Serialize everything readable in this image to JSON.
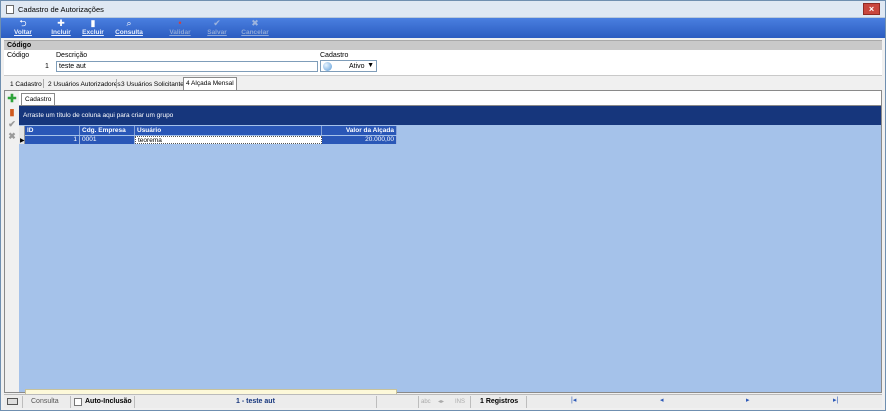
{
  "window": {
    "title": "Cadastro de Autorizações"
  },
  "toolbar": {
    "buttons": [
      {
        "label": "Voltar",
        "icon": "undo-icon",
        "glyph": "⮌"
      },
      {
        "label": "Incluir",
        "icon": "plus-icon",
        "glyph": "✚"
      },
      {
        "label": "Excluir",
        "icon": "trash-icon",
        "glyph": "▮"
      },
      {
        "label": "Consulta",
        "icon": "search-icon",
        "glyph": "🔍"
      },
      {
        "label": "Validar",
        "icon": "validate-icon",
        "glyph": "●"
      },
      {
        "label": "Salvar",
        "icon": "check-icon",
        "glyph": "✔"
      },
      {
        "label": "Cancelar",
        "icon": "cancel-icon",
        "glyph": "✖"
      }
    ]
  },
  "header": {
    "section_title": "Código"
  },
  "form": {
    "codigo_label": "Código",
    "codigo_value": "1",
    "descricao_label": "Descrição",
    "descricao_value": "teste aut",
    "cadastro_label": "Cadastro",
    "cadastro_value": "Ativo"
  },
  "tabs": [
    {
      "label": "1 Cadastro"
    },
    {
      "label": "2 Usuários Autorizadores"
    },
    {
      "label": "3 Usuários Solicitantes"
    },
    {
      "label": "4 Alçada Mensal"
    }
  ],
  "subtab": {
    "label": "Cadastro"
  },
  "grid": {
    "group_hint": "Arraste um título de coluna aqui para criar um grupo",
    "columns": [
      "ID",
      "Cdg. Empresa",
      "Usuário",
      "Valor da Alçada"
    ],
    "rows": [
      [
        "1",
        "0001",
        "teorema",
        "20.000,00"
      ]
    ]
  },
  "statusbar": {
    "mode": "Consulta",
    "auto_inclusao": "Auto-Inclusão",
    "current_record": "1 - teste aut",
    "abc": "abc",
    "ins": "INS",
    "records": "1 Registros"
  },
  "colors": {
    "toolbar": "#2b5cc0",
    "group_bar": "#16367c",
    "grid_bg": "#a5c2ea",
    "header": "#2a57b7"
  }
}
